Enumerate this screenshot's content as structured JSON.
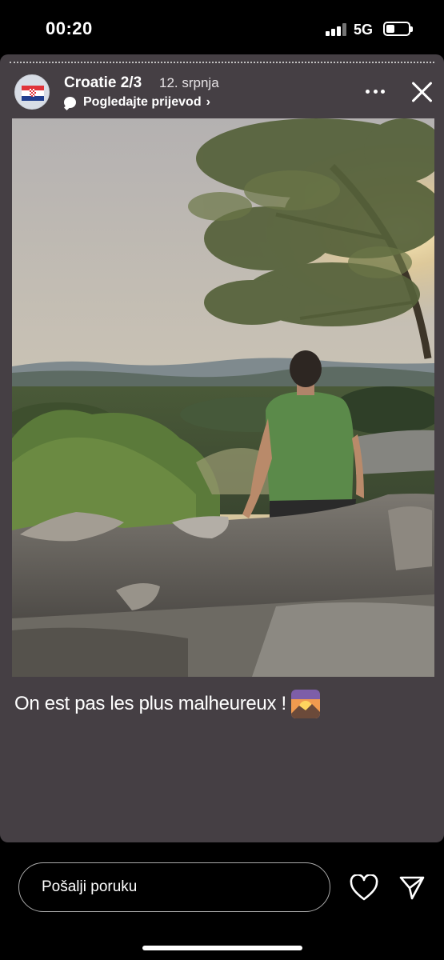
{
  "status_bar": {
    "time": "00:20",
    "network": "5G"
  },
  "story": {
    "title": "Croatie 2/3",
    "date": "12. srpnja",
    "translate_label": "Pogledajte prijevod",
    "chevron": "›",
    "caption": "On est pas les plus malheureux !",
    "avatar_icon": "croatia-flag",
    "caption_emoji": "sunrise-over-mountains"
  },
  "footer": {
    "message_placeholder": "Pošalji poruku"
  },
  "colors": {
    "background": "#000000",
    "story_background": "#453f44"
  }
}
